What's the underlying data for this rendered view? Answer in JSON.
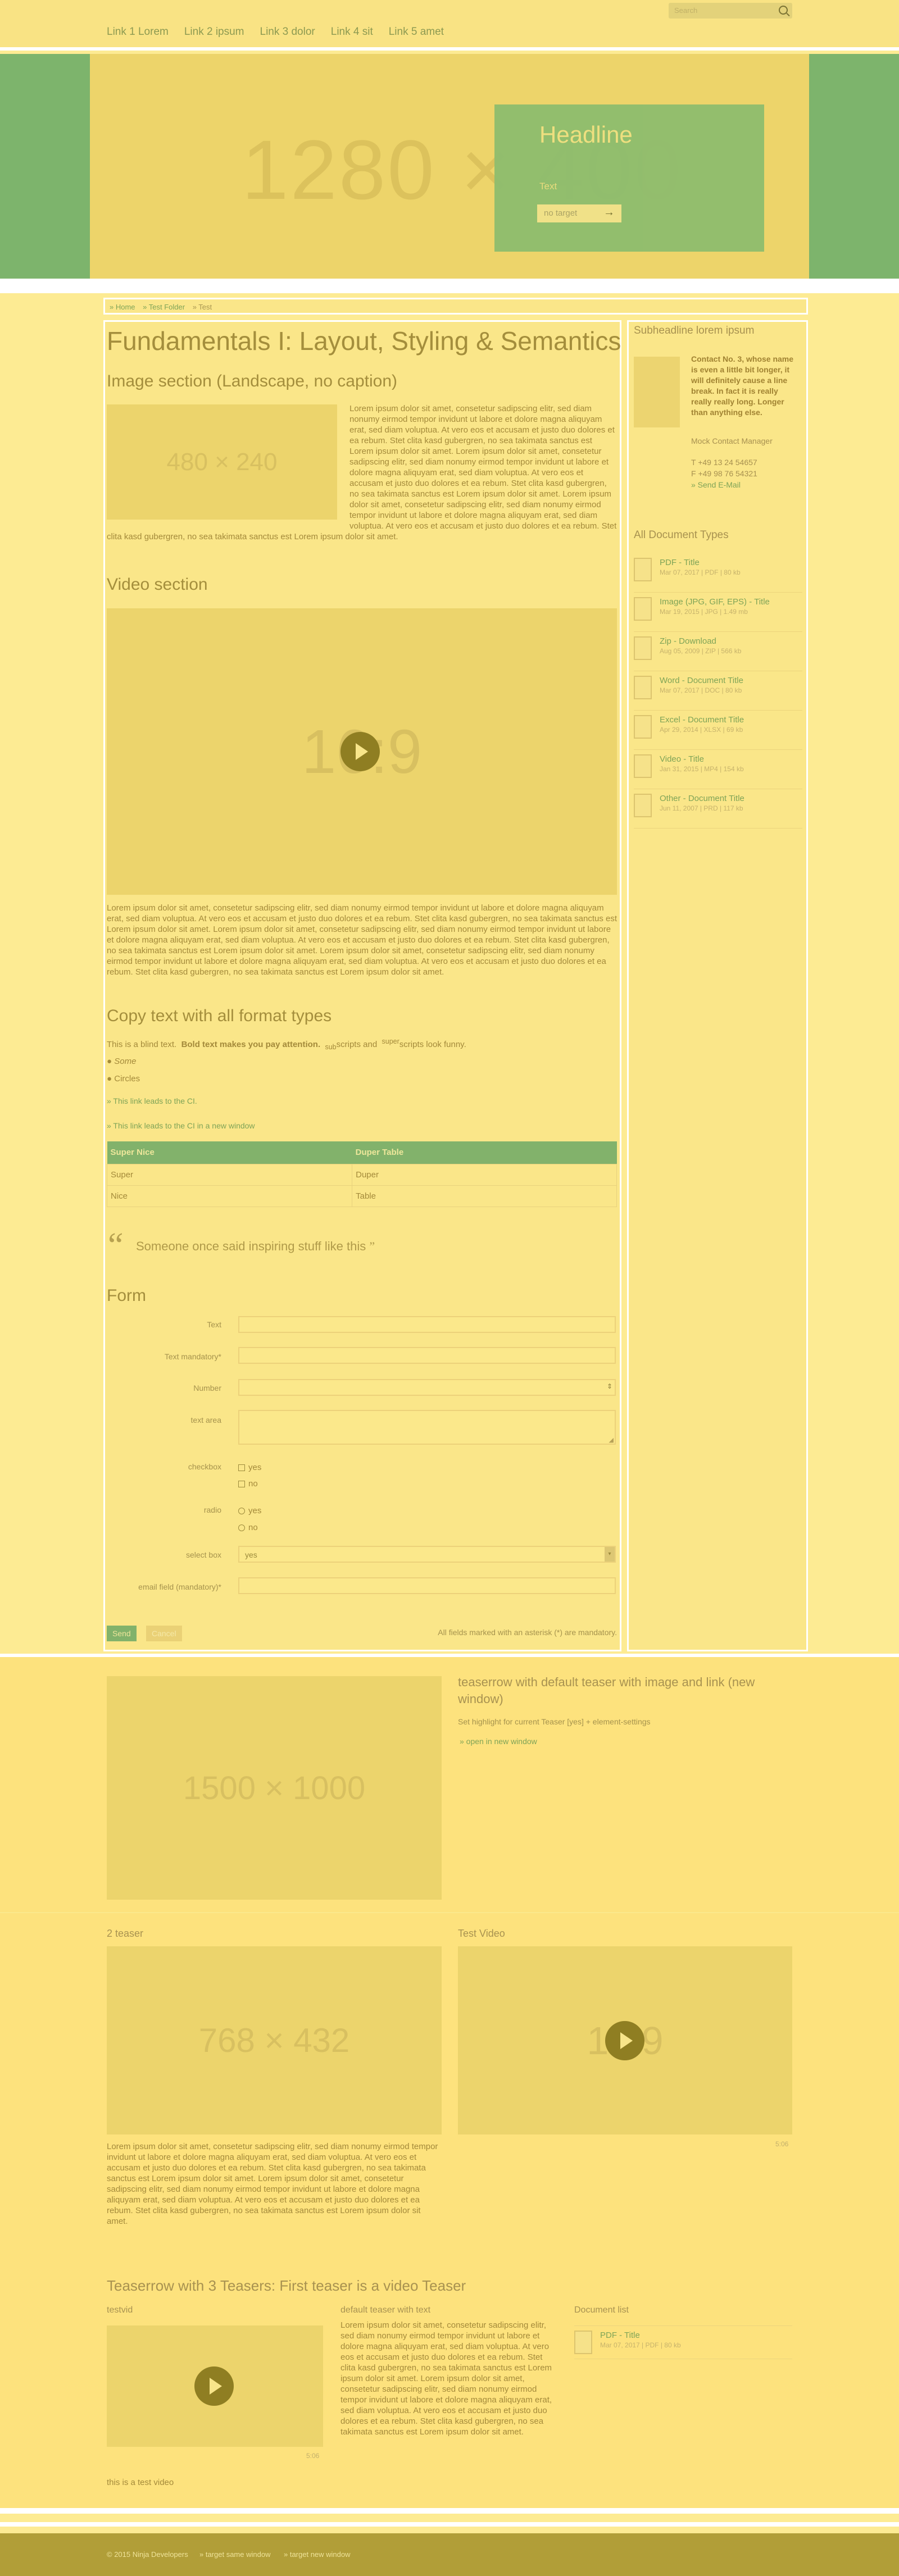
{
  "nav": [
    "Link 1 Lorem",
    "Link 2 ipsum",
    "Link 3 dolor",
    "Link 4 sit",
    "Link 5 amet"
  ],
  "search": {
    "placeholder": "Search"
  },
  "hero": {
    "placeholder": "1280 × 400",
    "headline": "Headline",
    "text": "Text",
    "button": "no target"
  },
  "breadcrumb": [
    "» Home",
    "» Test Folder",
    "» Test"
  ],
  "page_title": "Fundamentals I: Layout, Styling & Semantics",
  "image_section": {
    "title": "Image section (Landscape, no caption)",
    "placeholder": "480 × 240",
    "text": "Lorem ipsum dolor sit amet, consetetur sadipscing elitr, sed diam nonumy eirmod tempor invidunt ut labore et dolore magna aliquyam erat, sed diam voluptua. At vero eos et accusam et justo duo dolores et ea rebum. Stet clita kasd gubergren, no sea takimata sanctus est Lorem ipsum dolor sit amet. Lorem ipsum dolor sit amet, consetetur sadipscing elitr, sed diam nonumy eirmod tempor invidunt ut labore et dolore magna aliquyam erat, sed diam voluptua. At vero eos et accusam et justo duo dolores et ea rebum. Stet clita kasd gubergren, no sea takimata sanctus est Lorem ipsum dolor sit amet. Lorem ipsum dolor sit amet, consetetur sadipscing elitr, sed diam nonumy eirmod tempor invidunt ut labore et dolore magna aliquyam erat, sed diam voluptua. At vero eos et accusam et justo duo dolores et ea rebum. Stet clita kasd gubergren, no sea takimata sanctus est Lorem ipsum dolor sit amet."
  },
  "video_section": {
    "title": "Video section",
    "placeholder": "16:9",
    "text": "Lorem ipsum dolor sit amet, consetetur sadipscing elitr, sed diam nonumy eirmod tempor invidunt ut labore et dolore magna aliquyam erat, sed diam voluptua. At vero eos et accusam et justo duo dolores et ea rebum. Stet clita kasd gubergren, no sea takimata sanctus est Lorem ipsum dolor sit amet. Lorem ipsum dolor sit amet, consetetur sadipscing elitr, sed diam nonumy eirmod tempor invidunt ut labore et dolore magna aliquyam erat, sed diam voluptua. At vero eos et accusam et justo duo dolores et ea rebum. Stet clita kasd gubergren, no sea takimata sanctus est Lorem ipsum dolor sit amet. Lorem ipsum dolor sit amet, consetetur sadipscing elitr, sed diam nonumy eirmod tempor invidunt ut labore et dolore magna aliquyam erat, sed diam voluptua. At vero eos et accusam et justo duo dolores et ea rebum. Stet clita kasd gubergren, no sea takimata sanctus est Lorem ipsum dolor sit amet."
  },
  "copy": {
    "title": "Copy text with all format types",
    "blind": "This is a blind text.",
    "bold": "Bold text makes you pay attention.",
    "sub_pre": "sub",
    "sub_rest": "scripts and",
    "sup_pre": "super",
    "sup_rest": "scripts look funny.",
    "list": [
      "Some",
      "Circles"
    ],
    "link1": "» This link leads to the CI.",
    "link2": "» This link leads to the CI in a new window"
  },
  "table": {
    "headers": [
      "Super Nice",
      "Duper Table"
    ],
    "rows": [
      [
        "Super",
        "Duper"
      ],
      [
        "Nice",
        "Table"
      ]
    ]
  },
  "quote": "Someone once said inspiring stuff like this",
  "form": {
    "title": "Form",
    "labels": {
      "text": "Text",
      "mandatory": "Text mandatory*",
      "number": "Number",
      "textarea": "text area",
      "checkbox": "checkbox",
      "radio": "radio",
      "select": "select box",
      "email": "email field (mandatory)*"
    },
    "check_yes": "yes",
    "check_no": "no",
    "radio_yes": "yes",
    "radio_no": "no",
    "select_value": "yes",
    "send": "Send",
    "cancel": "Cancel",
    "note": "All fields marked with an asterisk (*) are mandatory."
  },
  "contact": {
    "title": "Subheadline lorem ipsum",
    "name": "Contact No. 3, whose name is even a little bit longer, it will definitely cause a line break. In fact it is really really really long. Longer than anything else.",
    "role": "Mock Contact Manager",
    "tel": "T +49 13 24 54657",
    "fax": "F +49 98 76 54321",
    "email": "» Send E-Mail"
  },
  "documents": {
    "title": "All Document Types",
    "items": [
      {
        "title": "PDF - Title",
        "meta": "Mar 07, 2017 | PDF | 80 kb",
        "icon": "pdf-icon"
      },
      {
        "title": "Image (JPG, GIF, EPS) - Title",
        "meta": "Mar 19, 2015 | JPG | 1.49 mb",
        "icon": "image-file-icon"
      },
      {
        "title": "Zip - Download",
        "meta": "Aug 05, 2009 | ZIP | 566 kb",
        "icon": "zip-icon"
      },
      {
        "title": "Word - Document Title",
        "meta": "Mar 07, 2017 | DOC | 80 kb",
        "icon": "word-icon"
      },
      {
        "title": "Excel - Document Title",
        "meta": "Apr 29, 2014 | XLSX | 69 kb",
        "icon": "excel-icon"
      },
      {
        "title": "Video - Title",
        "meta": "Jan 31, 2015 | MP4 | 154 kb",
        "icon": "video-file-icon"
      },
      {
        "title": "Other - Document Title",
        "meta": "Jun 11, 2007 | PRD | 117 kb",
        "icon": "other-file-icon"
      }
    ]
  },
  "teaser_row": {
    "placeholder": "1500 × 1000",
    "title": "teaserrow with default teaser with image and link (new window)",
    "text": "Set highlight for current Teaser [yes] + element-settings",
    "link": "» open in new window"
  },
  "two_teaser": {
    "left_title": "2 teaser",
    "left_placeholder": "768 × 432",
    "left_text": "Lorem ipsum dolor sit amet, consetetur sadipscing elitr, sed diam nonumy eirmod tempor invidunt ut labore et dolore magna aliquyam erat, sed diam voluptua. At vero eos et accusam et justo duo dolores et ea rebum. Stet clita kasd gubergren, no sea takimata sanctus est Lorem ipsum dolor sit amet. Lorem ipsum dolor sit amet, consetetur sadipscing elitr, sed diam nonumy eirmod tempor invidunt ut labore et dolore magna aliquyam erat, sed diam voluptua. At vero eos et accusam et justo duo dolores et ea rebum. Stet clita kasd gubergren, no sea takimata sanctus est Lorem ipsum dolor sit amet.",
    "right_title": "Test Video",
    "right_placeholder": "16:9",
    "right_caption": "5:06"
  },
  "three_teaser": {
    "title": "Teaserrow with 3 Teasers: First teaser is a video Teaser",
    "t1_title": "testvid",
    "t1_caption": "5:06",
    "t1_text": "this is a test video",
    "t2_title": "default teaser with text",
    "t2_text": "Lorem ipsum dolor sit amet, consetetur sadipscing elitr, sed diam nonumy eirmod tempor invidunt ut labore et dolore magna aliquyam erat, sed diam voluptua. At vero eos et accusam et justo duo dolores et ea rebum. Stet clita kasd gubergren, no sea takimata sanctus est Lorem ipsum dolor sit amet. Lorem ipsum dolor sit amet, consetetur sadipscing elitr, sed diam nonumy eirmod tempor invidunt ut labore et dolore magna aliquyam erat, sed diam voluptua. At vero eos et accusam et justo duo dolores et ea rebum. Stet clita kasd gubergren, no sea takimata sanctus est Lorem ipsum dolor sit amet.",
    "t3_title": "Document list",
    "t3_doc_title": "PDF - Title",
    "t3_doc_meta": "Mar 07, 2017 | PDF | 80 kb"
  },
  "footer": {
    "copyright": "© 2015 Ninja Developers",
    "link1": "» target same window",
    "link2": "» target new window"
  }
}
